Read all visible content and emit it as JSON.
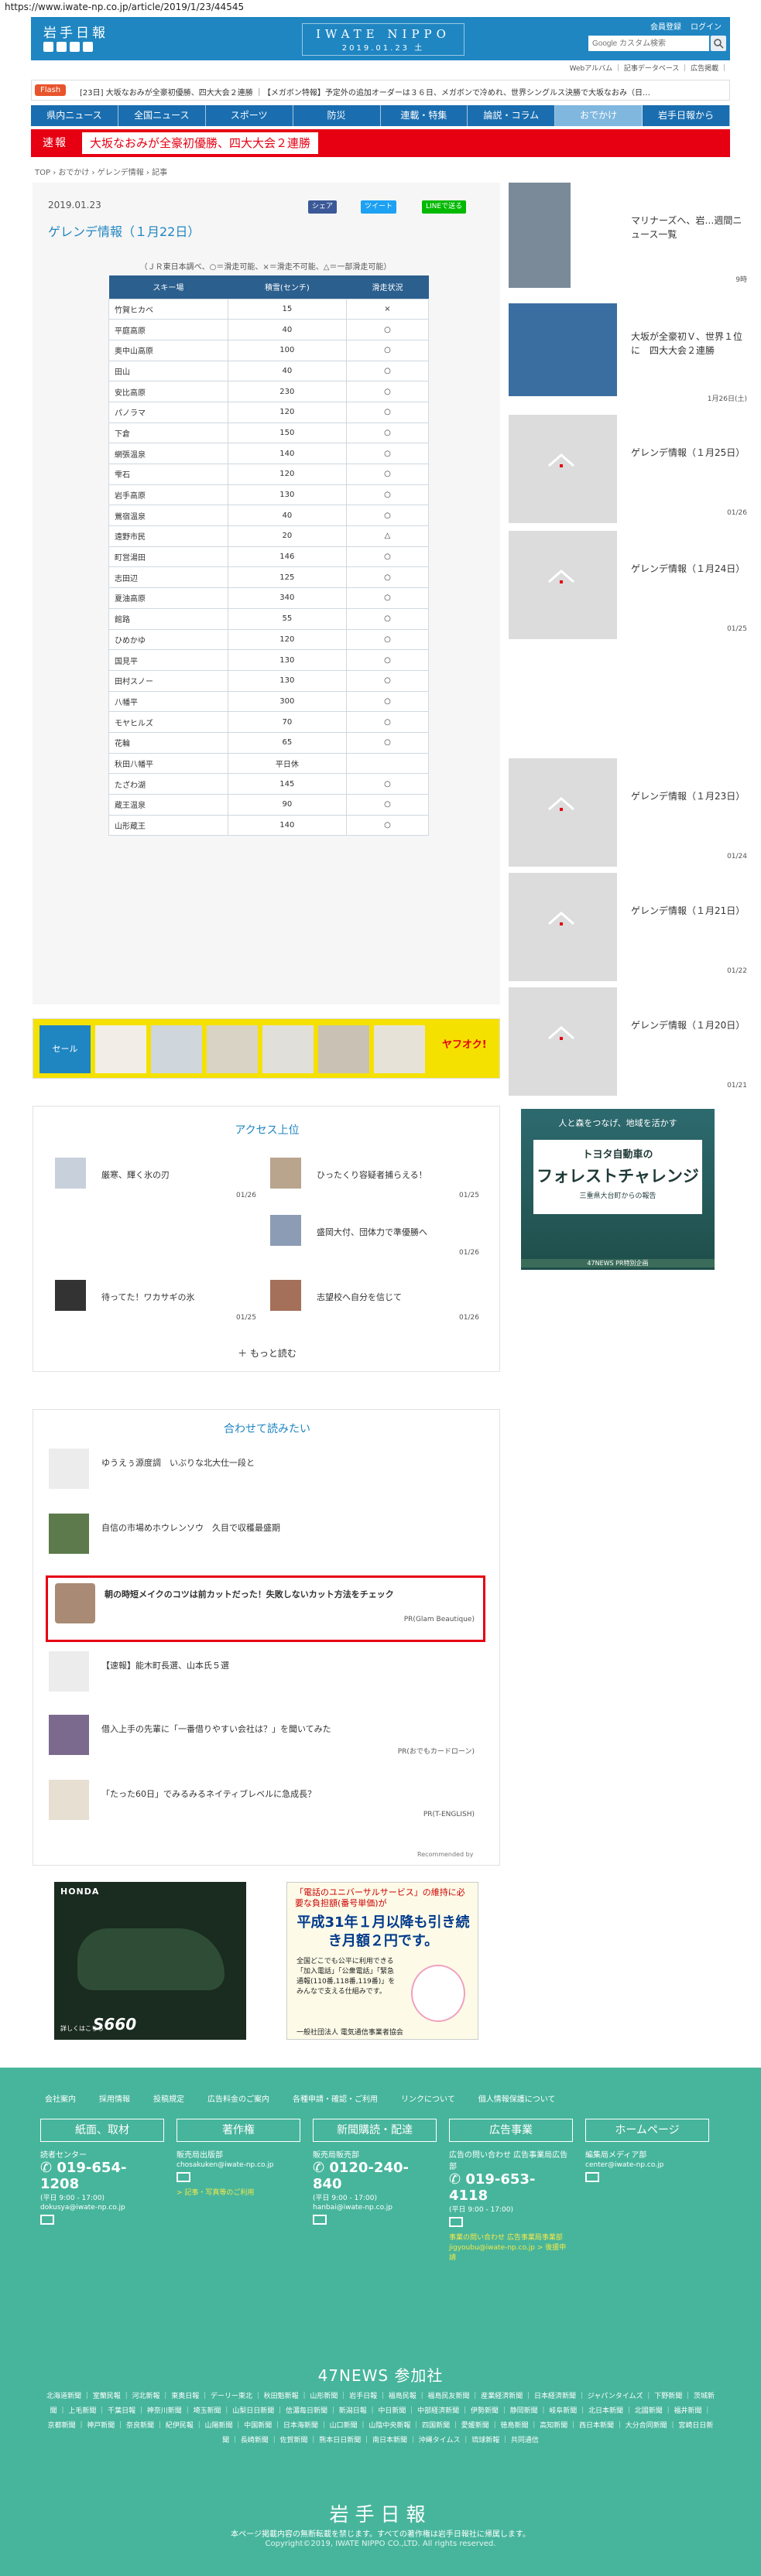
{
  "url": "https://www.iwate-np.co.jp/article/2019/1/23/44545",
  "header": {
    "logo": "岩手日報",
    "masthead_en": "IWATE NIPPO",
    "masthead_date": "2019.01.23 土",
    "member_register": "会員登録",
    "login": "ログイン",
    "search_placeholder": "Google カスタム検索",
    "sublinks": "Webアルバム ｜ 記事データベース ｜ 広告掲載 ｜"
  },
  "flash": {
    "badge": "Flash",
    "text": "[23日] 大坂なおみが全豪初優勝、四大大会２連勝 ｜【メガボン特報】予定外の追加オーダーは３６日、メガボンで冷めれ、世界シングルス決勝で大坂なおみ（日…"
  },
  "nav": [
    "県内ニュース",
    "全国ニュース",
    "スポーツ",
    "防災",
    "連載・特集",
    "論説・コラム",
    "おでかけ",
    "岩手日報から"
  ],
  "nav_active": 6,
  "breaking": {
    "label": "速報",
    "text": "大坂なおみが全豪初優勝、四大大会２連勝"
  },
  "breadcrumb": "TOP › おでかけ › ゲレンデ情報 › 記事",
  "article": {
    "date": "2019.01.23",
    "title": "ゲレンデ情報（１月22日）",
    "share_fb": "シェア",
    "share_tw": "ツイート",
    "share_line": "LINEで送る",
    "note": "（ＪＲ東日本調べ、○＝滑走可能、×＝滑走不可能、△＝一部滑走可能）",
    "table_headers": [
      "スキー場",
      "積雪(センチ)",
      "滑走状況"
    ],
    "rows": [
      [
        "竹賀ヒカベ",
        "15",
        "×"
      ],
      [
        "平庭高原",
        "40",
        "○"
      ],
      [
        "奥中山高原",
        "100",
        "○"
      ],
      [
        "田山",
        "40",
        "○"
      ],
      [
        "安比高原",
        "230",
        "○"
      ],
      [
        "パノラマ",
        "120",
        "○"
      ],
      [
        "下倉",
        "150",
        "○"
      ],
      [
        "網張温泉",
        "140",
        "○"
      ],
      [
        "雫石",
        "120",
        "○"
      ],
      [
        "岩手高原",
        "130",
        "○"
      ],
      [
        "鶯宿温泉",
        "40",
        "○"
      ],
      [
        "遠野市民",
        "20",
        "△"
      ],
      [
        "町営湯田",
        "146",
        "○"
      ],
      [
        "志田辺",
        "125",
        "○"
      ],
      [
        "夏油高原",
        "340",
        "○"
      ],
      [
        "館路",
        "55",
        "○"
      ],
      [
        "ひめかゆ",
        "120",
        "○"
      ],
      [
        "国見平",
        "130",
        "○"
      ],
      [
        "田村スノー",
        "130",
        "○"
      ],
      [
        "八幡平",
        "300",
        "○"
      ],
      [
        "モヤヒルズ",
        "70",
        "○"
      ],
      [
        "花輪",
        "65",
        "○"
      ],
      [
        "秋田八幡平",
        "平日休",
        ""
      ],
      [
        "たざわ湖",
        "145",
        "○"
      ],
      [
        "蔵王温泉",
        "90",
        "○"
      ],
      [
        "山形蔵王",
        "140",
        "○"
      ]
    ]
  },
  "ad_strip": {
    "sale": "セール",
    "brand": "ヤフオク!"
  },
  "access": {
    "title": "アクセス上位",
    "items": [
      {
        "title": "厳寒、輝く氷の刃",
        "date": "01/26"
      },
      {
        "title": "ひったくり容疑者捕らえる！",
        "date": "01/25"
      },
      {
        "title": "盛岡大付、団体力で準優勝へ",
        "date": "01/26"
      },
      {
        "title": "待ってた！ワカサギの氷",
        "date": "01/25"
      },
      {
        "title": "志望校へ自分を信じて",
        "date": "01/26"
      }
    ],
    "more": "もっと読む"
  },
  "related": {
    "title": "合わせて読みたい",
    "items": [
      {
        "title": "ゆうえぅ源度調　いぶりな北大仕一段と",
        "src": ""
      },
      {
        "title": "自信の市場めホウレンソウ　久目で収穫最盛期",
        "src": ""
      },
      {
        "title": "朝の時短メイクのコツは前カットだった！失敗しないカット方法をチェック",
        "src": "PR(Glam Beautique)"
      },
      {
        "title": "【速報】能木町長選、山本氏５選",
        "src": ""
      },
      {
        "title": "借入上手の先輩に「一番借りやすい会社は？」を聞いてみた",
        "src": "PR(おでもカードローン)"
      },
      {
        "title": "「たった60日」でみるみるネイティブレベルに急成長？",
        "src": "PR(T-ENGLISH)"
      }
    ],
    "rec": "Recommended by"
  },
  "ads": {
    "honda_logo": "HONDA",
    "honda_model": "S660",
    "honda_sub": "詳しくはこちら",
    "univ_h": "「電話のユニバーサルサービス」の維持に必要な負担額(番号単価)が",
    "univ_big": "平成31年１月以降も引き続き月額２円です。",
    "univ_body": "全国どこでも公平に利用できる「加入電話」「公衆電話」「緊急通報(110番,118番,119番)」をみんなで支える仕組みです。",
    "univ_foot": "一般社団法人 電気通信事業者協会"
  },
  "sidebar": [
    {
      "title": "マリナーズへ、岩…週間ニュース一覧",
      "date": "9時"
    },
    {
      "title": "大坂が全豪初Ｖ、世界１位に　四大大会２連勝",
      "date": "1月26日(土)"
    },
    {
      "title": "ゲレンデ情報（１月25日）",
      "date": "01/26"
    },
    {
      "title": "ゲレンデ情報（１月24日）",
      "date": "01/25"
    },
    {
      "title": "ゲレンデ情報（１月23日）",
      "date": "01/24"
    },
    {
      "title": "ゲレンデ情報（１月21日）",
      "date": "01/22"
    },
    {
      "title": "ゲレンデ情報（１月20日）",
      "date": "01/21"
    }
  ],
  "toyota": {
    "top": "人と森をつなげ、地域を活かす",
    "l1": "トヨタ自動車の",
    "l2": "フォレストチャレンジ",
    "l3": "三重県大台町からの報告",
    "foot": "47NEWS PR特別企画"
  },
  "footer": {
    "links": [
      "会社案内",
      "採用情報",
      "投稿規定",
      "広告料金のご案内",
      "各種申請・確認・ご利用",
      "リンクについて",
      "個人情報保護について"
    ],
    "cols": [
      {
        "head": "紙面、取材",
        "label": "読者センター",
        "phone": "019-654-1208",
        "hours": "(平日 9:00 - 17:00)",
        "mail": "dokusya@iwate-np.co.jp",
        "extra": ""
      },
      {
        "head": "著作権",
        "label": "販売局出版部",
        "phone": "",
        "hours": "",
        "mail": "chosakuken@iwate-np.co.jp",
        "extra": "> 記事・写真等のご利用"
      },
      {
        "head": "新聞購読・配達",
        "label": "販売局販売部",
        "phone": "0120-240-840",
        "hours": "(平日 9:00 - 17:00)",
        "mail": "hanbai@iwate-np.co.jp",
        "extra": ""
      },
      {
        "head": "広告事業",
        "label": "広告の問い合わせ 広告事業局広告部",
        "phone": "019-653-4118",
        "hours": "(平日 9:00 - 17:00)",
        "mail": "",
        "extra": "事業の問い合わせ 広告事業局事業部 jigyoubu@iwate-np.co.jp > 後援申請"
      },
      {
        "head": "ホームページ",
        "label": "編集局メディア部",
        "phone": "",
        "hours": "",
        "mail": "center@iwate-np.co.jp",
        "extra": ""
      }
    ],
    "n47": "47NEWS 参加社",
    "n47list": "北海道新聞 ｜ 室蘭民報 ｜ 河北新報 ｜ 東奥日報 ｜ デーリー東北 ｜ 秋田魁新報 ｜ 山形新聞 ｜ 岩手日報 ｜ 福島民報 ｜ 福島民友新聞 ｜ 産業経済新聞 ｜ 日本経済新聞 ｜ ジャパンタイムズ ｜ 下野新聞 ｜ 茨城新聞 ｜ 上毛新聞 ｜ 千葉日報 ｜ 神奈川新聞 ｜ 埼玉新聞 ｜ 山梨日日新聞 ｜ 信濃毎日新聞 ｜ 新潟日報 ｜ 中日新聞 ｜ 中部経済新聞 ｜ 伊勢新聞 ｜ 静岡新聞 ｜ 岐阜新聞 ｜ 北日本新聞 ｜ 北國新聞 ｜ 福井新聞 ｜ 京都新聞 ｜ 神戸新聞 ｜ 奈良新聞 ｜ 紀伊民報 ｜ 山陽新聞 ｜ 中国新聞 ｜ 日本海新聞 ｜ 山口新聞 ｜ 山陰中央新報 ｜ 四国新聞 ｜ 愛媛新聞 ｜ 徳島新聞 ｜ 高知新聞 ｜ 西日本新聞 ｜ 大分合同新聞 ｜ 宮崎日日新聞 ｜ 長崎新聞 ｜ 佐賀新聞 ｜ 熊本日日新聞 ｜ 南日本新聞 ｜ 沖縄タイムス ｜ 琉球新報 ｜ 共同通信",
    "logo": "岩手日報",
    "copy1": "本ページ掲載内容の無断転載を禁じます。すべての著作権は岩手日報社に帰属します。",
    "copy2": "Copyright©2019, IWATE NIPPO CO.,LTD. All rights reserved."
  },
  "colors": {
    "brand": "#1f86c2",
    "nav": "#1a6eb0",
    "breaking": "#e60012",
    "footer": "#47b59c"
  }
}
